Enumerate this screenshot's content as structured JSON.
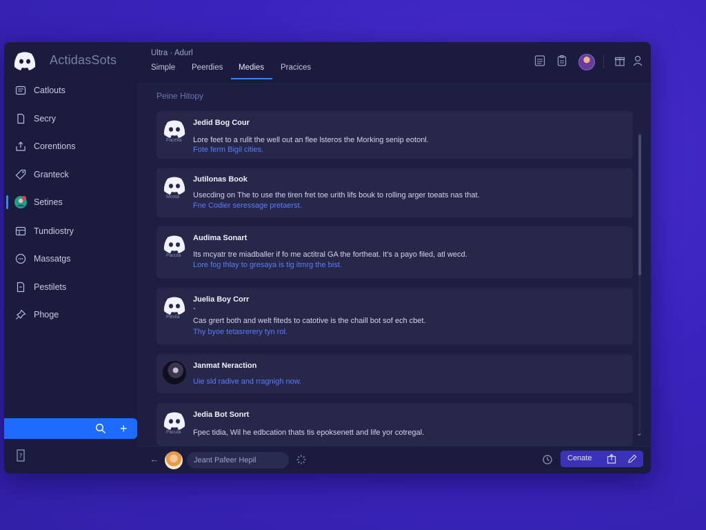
{
  "app": {
    "name": "ActidasSots"
  },
  "sidebar": {
    "items": [
      {
        "label": "Catlouts",
        "icon": "calendar-icon"
      },
      {
        "label": "Secry",
        "icon": "document-icon"
      },
      {
        "label": "Corentions",
        "icon": "share-icon"
      },
      {
        "label": "Granteck",
        "icon": "tag-icon"
      },
      {
        "label": "Setines",
        "icon": "settings-avatar-icon"
      },
      {
        "label": "Tundiostry",
        "icon": "table-icon"
      },
      {
        "label": "Massatgs",
        "icon": "message-icon"
      },
      {
        "label": "Pestilets",
        "icon": "file-icon"
      },
      {
        "label": "Phoge",
        "icon": "pin-icon"
      }
    ],
    "active_index": 4
  },
  "header": {
    "breadcrumb": "Ultra · Adurl",
    "tabs": [
      {
        "label": "Simple"
      },
      {
        "label": "Peerdies"
      },
      {
        "label": "Medies"
      },
      {
        "label": "Pracices"
      }
    ],
    "active_tab": 2
  },
  "main": {
    "section_title": "Peine Hitopy",
    "cards": [
      {
        "title": "Jedid Bog Cour",
        "logo_caption": "Facella",
        "body": "Lore feet to a rulit the well out an flee lsteros the Morking senip eotonl.",
        "link": "Fote ferm Bigil cities."
      },
      {
        "title": "Jutilonas Book",
        "logo_caption": "Mosta",
        "body": "Usecding on The to use the tiren fret toe urith lifs bouk to rolling arger toeats nas that.",
        "link": "Fne Codier seressage pretaerst."
      },
      {
        "title": "Audima Sonart",
        "logo_caption": "Pacula",
        "body": "Its mcyatr tre miadballer if fo me actitral GA the fortheat. It's a payo filed, atl wecd.",
        "link": "Lore fog thlay to gresaya is tig itmrg the bist."
      },
      {
        "title": "Juelia Boy Corr",
        "logo_caption": "Pleola",
        "dash": "-",
        "body": "Cas grert both and welt fiteds to catotive is the chaill bot sof ech cbet.",
        "link": "Thy byoe tetasrerery tyn rol."
      },
      {
        "title": "Janmat Neraction",
        "body": "",
        "link": "Uie sld radive and rragnigh now."
      },
      {
        "title": "Jedia Bot Sonrt",
        "logo_caption": "Pacula",
        "body": "Fpec tidia, Wil he edbcation thats tis epoksenett and life yor cotregal.",
        "link": ""
      }
    ]
  },
  "footer": {
    "input_value": "Jeant Pafeer Hepil",
    "create_label": "Cenate"
  },
  "colors": {
    "accent": "#3b82f6",
    "link": "#5b7cff",
    "create_button": "#3a32b8",
    "sidebar_blue_bar": "#1e6bff"
  }
}
